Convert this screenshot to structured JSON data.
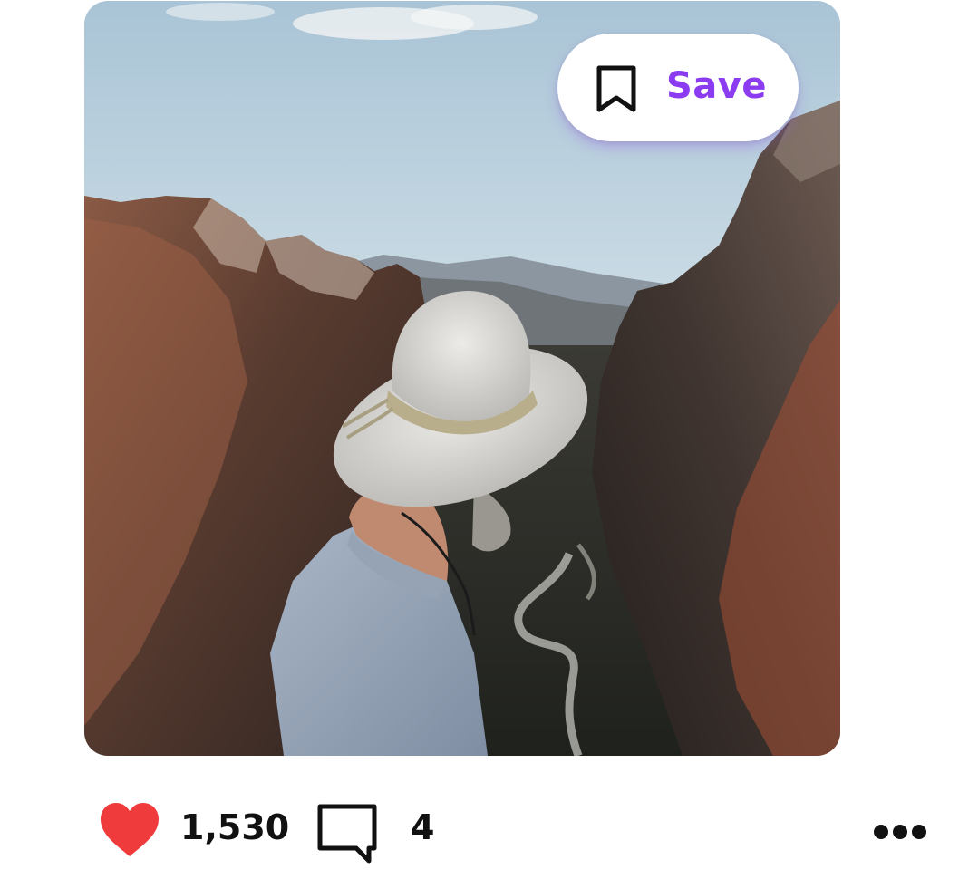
{
  "post": {
    "photo_alt": "man-in-hat-overlooking-canyon",
    "save": {
      "label": "Save",
      "icon": "bookmark-icon",
      "accent_color": "#8b3cf0"
    },
    "actions": {
      "like_icon": "heart-icon",
      "like_color": "#ef3b3b",
      "like_count": "1,530",
      "comment_icon": "comment-icon",
      "comment_count": "4",
      "more_icon": "more-dots-icon"
    }
  }
}
